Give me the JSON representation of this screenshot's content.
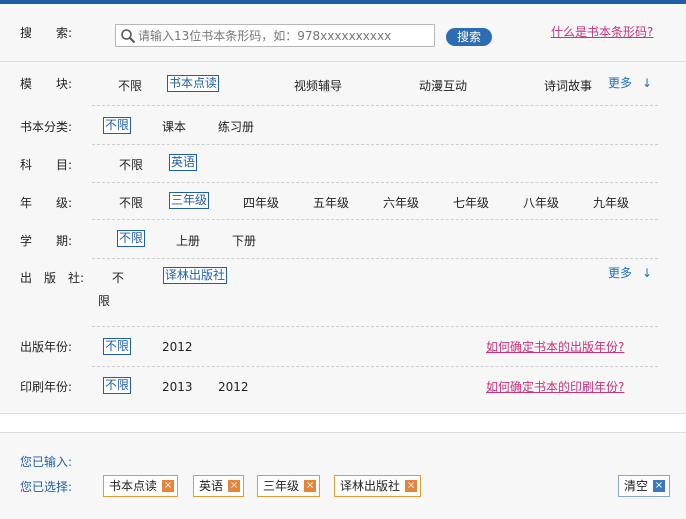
{
  "search": {
    "label": "搜　　索:",
    "placeholder": "请输入13位书本条形码，如：978xxxxxxxxxx",
    "button": "搜索",
    "help_link": "什么是书本条形码?"
  },
  "filters": {
    "module": {
      "label": "模　　块:",
      "options": [
        "不限",
        "书本点读",
        "视频辅导",
        "动漫互动",
        "诗词故事"
      ],
      "more": "更多",
      "more_arrow": "↓"
    },
    "category": {
      "label": "书本分类:",
      "options": [
        "不限",
        "课本",
        "练习册"
      ]
    },
    "subject": {
      "label": "科　　目:",
      "options": [
        "不限",
        "英语"
      ]
    },
    "grade": {
      "label": "年　　级:",
      "options": [
        "不限",
        "三年级",
        "四年级",
        "五年级",
        "六年级",
        "七年级",
        "八年级",
        "九年级"
      ]
    },
    "semester": {
      "label": "学　　期:",
      "options": [
        "不限",
        "上册",
        "下册"
      ]
    },
    "publisher": {
      "label": "出　版　社:",
      "unlimited_part1": "不",
      "unlimited_part2": "限",
      "options": [
        "译林出版社"
      ],
      "more": "更多",
      "more_arrow": "↓"
    },
    "pub_year": {
      "label": "出版年份:",
      "options": [
        "不限",
        "2012"
      ],
      "help_link": "如何确定书本的出版年份?"
    },
    "print_year": {
      "label": "印刷年份:",
      "options": [
        "不限",
        "2013",
        "2012"
      ],
      "help_link": "如何确定书本的印刷年份?"
    }
  },
  "selection": {
    "input_label": "您已输入:",
    "selected_label": "您已选择:",
    "chips": [
      "书本点读",
      "英语",
      "三年级",
      "译林出版社"
    ],
    "chip_close": "×",
    "clear_button": "清空"
  },
  "colors": {
    "accent": "#1f5fa8",
    "link_pink": "#c8327c",
    "chip_border": "#e39b2f"
  },
  "icons": {
    "search": "magnifier-icon",
    "close": "close-x-icon",
    "arrow": "arrow-down-icon"
  }
}
